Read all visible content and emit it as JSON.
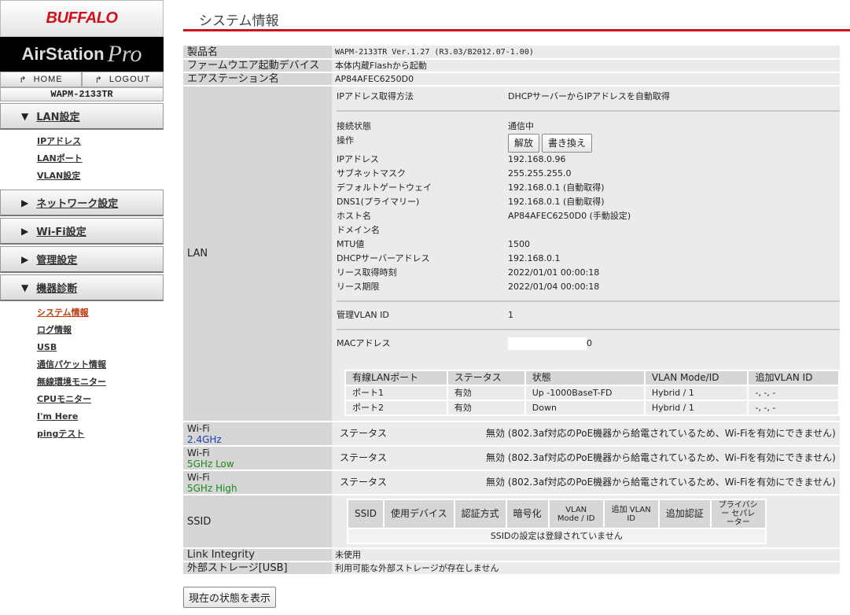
{
  "sidebar": {
    "brand": "BUFFALO",
    "product_line": "AirStation",
    "product_line_suffix": "Pro",
    "home": "HOME",
    "logout": "LOGOUT",
    "model": "WAPM-2133TR",
    "menus": [
      {
        "label": "LAN設定",
        "expanded": true,
        "items": [
          "IPアドレス",
          "LANポート",
          "VLAN設定"
        ]
      },
      {
        "label": "ネットワーク設定",
        "expanded": false,
        "items": []
      },
      {
        "label": "Wi-Fi設定",
        "expanded": false,
        "items": []
      },
      {
        "label": "管理設定",
        "expanded": false,
        "items": []
      },
      {
        "label": "機器診断",
        "expanded": true,
        "items": [
          "システム情報",
          "ログ情報",
          "USB",
          "通信パケット情報",
          "無線環境モニター",
          "CPUモニター",
          "I'm Here",
          "pingテスト"
        ]
      }
    ]
  },
  "page": {
    "title": "システム情報"
  },
  "info": {
    "product_label": "製品名",
    "product": "WAPM-2133TR Ver.1.27 (R3.03/B2012.07-1.00)",
    "fw_label": "ファームウエア起動デバイス",
    "fw": "本体内蔵Flashから起動",
    "name_label": "エアステーション名",
    "name": "AP84AFEC6250D0",
    "lan_label": "LAN",
    "lan": {
      "ip_method_label": "IPアドレス取得方法",
      "ip_method": "DHCPサーバーからIPアドレスを自動取得",
      "conn_label": "接続状態",
      "conn": "通信中",
      "op_label": "操作",
      "release": "解放",
      "renew": "書き換え",
      "rows": [
        [
          "IPアドレス",
          "192.168.0.96"
        ],
        [
          "サブネットマスク",
          "255.255.255.0"
        ],
        [
          "デフォルトゲートウェイ",
          "192.168.0.1 (自動取得)"
        ],
        [
          "DNS1(プライマリー)",
          "192.168.0.1 (自動取得)"
        ],
        [
          "ホスト名",
          "AP84AFEC6250D0 (手動設定)"
        ],
        [
          "ドメイン名",
          ""
        ],
        [
          "MTU値",
          "1500"
        ],
        [
          "DHCPサーバーアドレス",
          "192.168.0.1"
        ],
        [
          "リース取得時刻",
          "2022/01/01 00:00:18"
        ],
        [
          "リース期限",
          "2022/01/04 00:00:18"
        ]
      ],
      "vlan_label": "管理VLAN ID",
      "vlan": "1",
      "mac_label": "MACアドレス",
      "mac_suffix": "0",
      "ports_header": [
        "有線LANポート",
        "ステータス",
        "状態",
        "VLAN Mode/ID",
        "追加VLAN ID"
      ],
      "ports": [
        [
          "ポート1",
          "有効",
          "Up -1000BaseT-FD",
          "Hybrid / 1",
          "-, -, -"
        ],
        [
          "ポート2",
          "有効",
          "Down",
          "Hybrid / 1",
          "-, -, -"
        ]
      ]
    },
    "wifi": [
      {
        "label": "Wi-Fi",
        "band": "2.4GHz",
        "color": "#1a3fb0"
      },
      {
        "label": "Wi-Fi",
        "band": "5GHz Low",
        "color": "#1a8a1a"
      },
      {
        "label": "Wi-Fi",
        "band": "5GHz High",
        "color": "#1a8a1a"
      }
    ],
    "wifi_status_label": "ステータス",
    "wifi_status": "無効 (802.3af対応のPoE機器から給電されているため、Wi-Fiを有効にできません)",
    "ssid_label": "SSID",
    "ssid_header": [
      "SSID",
      "使用デバイス",
      "認証方式",
      "暗号化",
      "VLAN Mode / ID",
      "追加 VLAN ID",
      "追加認証",
      "プライバシー セパレーター"
    ],
    "ssid_empty": "SSIDの設定は登録されていません",
    "li_label": "Link Integrity",
    "li": "未使用",
    "usb_label": "外部ストレージ[USB]",
    "usb": "利用可能な外部ストレージが存在しません"
  },
  "refresh_button": "現在の状態を表示"
}
